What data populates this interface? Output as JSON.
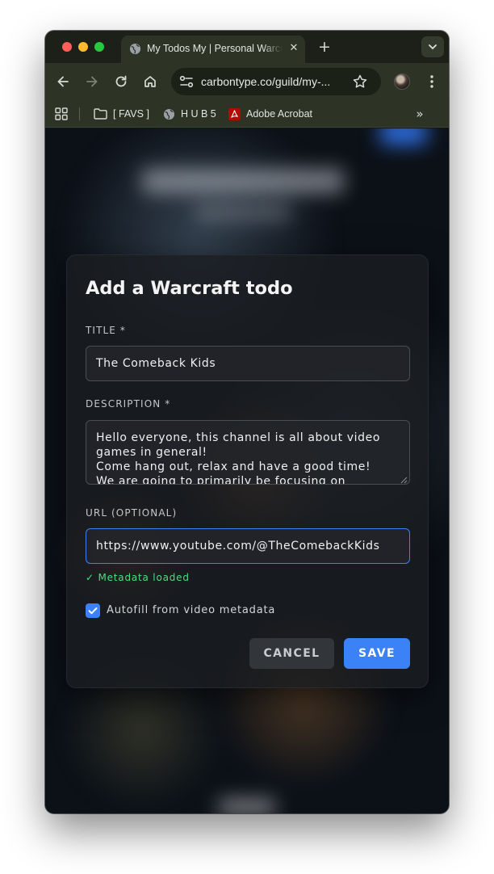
{
  "browser": {
    "tab": {
      "title": "My Todos My | Personal Warcraft"
    },
    "address": {
      "url": "carbontype.co/guild/my-..."
    },
    "bookmarks": [
      {
        "label": "[ FAVS ]",
        "icon": "folder-icon"
      },
      {
        "label": "H U B 5",
        "icon": "globe-icon"
      },
      {
        "label": "Adobe Acrobat",
        "icon": "acrobat-icon"
      }
    ]
  },
  "modal": {
    "title": "Add a Warcraft todo",
    "title_field": {
      "label": "TITLE *",
      "value": "The Comeback Kids"
    },
    "description_field": {
      "label": "DESCRIPTION *",
      "value": "Hello everyone, this channel is all about video games in general!\nCome hang out, relax and have a good time!\nWe are going to primarily be focusing on"
    },
    "url_field": {
      "label": "URL (OPTIONAL)",
      "value": "https://www.youtube.com/@TheComebackKids"
    },
    "metadata_status": "✓ Metadata loaded",
    "autofill": {
      "label": "Autofill from video metadata",
      "checked": true
    },
    "cancel_label": "CANCEL",
    "save_label": "SAVE"
  },
  "colors": {
    "accent": "#3b82f6",
    "success": "#4ade80",
    "browser_chrome": "#2d3426"
  }
}
